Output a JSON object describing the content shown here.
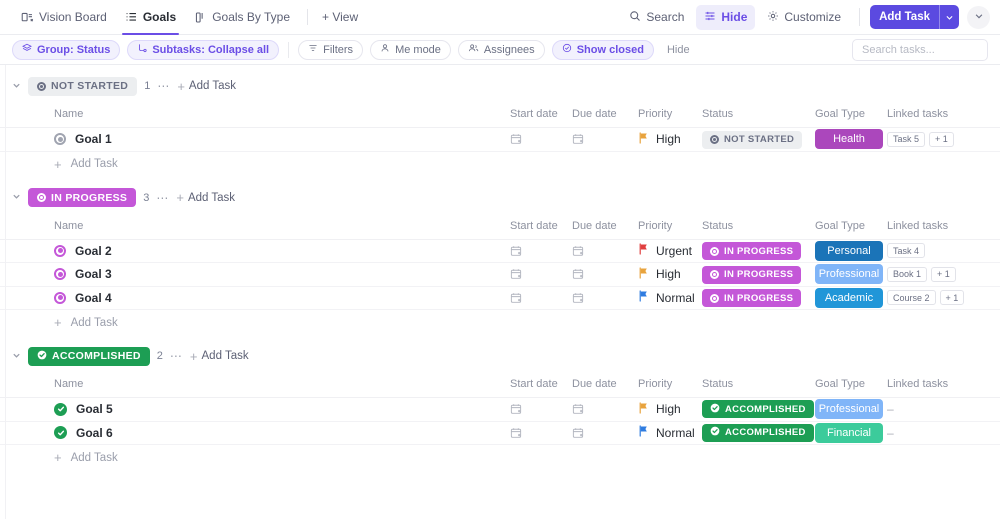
{
  "topbar": {
    "tabs": [
      {
        "label": "Vision Board",
        "icon": "board-icon",
        "active": false
      },
      {
        "label": "Goals",
        "icon": "list-icon",
        "active": true
      },
      {
        "label": "Goals By Type",
        "icon": "columns-icon",
        "active": false
      }
    ],
    "add_view_label": "+ View",
    "search_label": "Search",
    "hide_label": "Hide",
    "customize_label": "Customize",
    "add_task_label": "Add Task"
  },
  "filterbar": {
    "group_label": "Group: Status",
    "subtasks_label": "Subtasks: Collapse all",
    "filters_label": "Filters",
    "me_mode_label": "Me mode",
    "assignees_label": "Assignees",
    "show_closed_label": "Show closed",
    "hide_label": "Hide",
    "search_placeholder": "Search tasks...",
    "search_value": ""
  },
  "columns": {
    "name": "Name",
    "start_date": "Start date",
    "due_date": "Due date",
    "priority": "Priority",
    "status": "Status",
    "goal_type": "Goal Type",
    "linked_tasks": "Linked tasks"
  },
  "add_task_row_label": "Add Task",
  "group_add_task_label": "Add Task",
  "groups": [
    {
      "id": "not-started",
      "status_label": "NOT STARTED",
      "status_style": "notstarted",
      "count": "1",
      "rows": [
        {
          "name": "Goal 1",
          "icon": "radio-grey-icon",
          "priority": "High",
          "priority_color": "#e8a33d",
          "status_label": "NOT STARTED",
          "status_style": "notstarted",
          "goal_type": "Health",
          "goal_type_color": "#ab47bc",
          "linked": [
            "Task 5",
            "+ 1"
          ]
        }
      ]
    },
    {
      "id": "in-progress",
      "status_label": "IN PROGRESS",
      "status_style": "inprog",
      "count": "3",
      "rows": [
        {
          "name": "Goal 2",
          "icon": "radio-purple-icon",
          "priority": "Urgent",
          "priority_color": "#e03e3e",
          "status_label": "IN PROGRESS",
          "status_style": "inprog",
          "goal_type": "Personal",
          "goal_type_color": "#1b74b8",
          "linked": [
            "Task 4"
          ]
        },
        {
          "name": "Goal 3",
          "icon": "radio-purple-icon",
          "priority": "High",
          "priority_color": "#e8a33d",
          "status_label": "IN PROGRESS",
          "status_style": "inprog",
          "goal_type": "Professional",
          "goal_type_color": "#80b5f8",
          "linked": [
            "Book 1",
            "+ 1"
          ]
        },
        {
          "name": "Goal 4",
          "icon": "radio-purple-icon",
          "priority": "Normal",
          "priority_color": "#2f7ce0",
          "status_label": "IN PROGRESS",
          "status_style": "inprog",
          "goal_type": "Academic",
          "goal_type_color": "#2196d8",
          "linked": [
            "Course 2",
            "+ 1"
          ]
        }
      ]
    },
    {
      "id": "accomplished",
      "status_label": "ACCOMPLISHED",
      "status_style": "done",
      "count": "2",
      "rows": [
        {
          "name": "Goal 5",
          "icon": "check-green-icon",
          "priority": "High",
          "priority_color": "#e8a33d",
          "status_label": "ACCOMPLISHED",
          "status_style": "done",
          "goal_type": "Professional",
          "goal_type_color": "#80b5f8",
          "linked": []
        },
        {
          "name": "Goal 6",
          "icon": "check-green-icon",
          "priority": "Normal",
          "priority_color": "#2f7ce0",
          "status_label": "ACCOMPLISHED",
          "status_style": "done",
          "goal_type": "Financial",
          "goal_type_color": "#3ccb9b",
          "linked": []
        }
      ]
    }
  ],
  "empty_linked_placeholder": "–"
}
